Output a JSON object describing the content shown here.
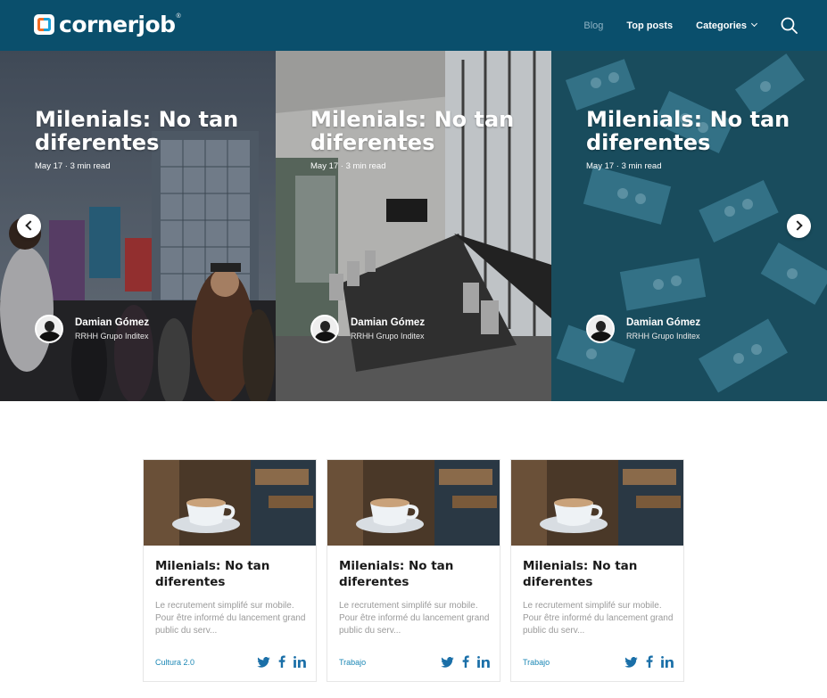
{
  "header": {
    "logo_text": "cornerjob",
    "logo_tm": "®",
    "nav": {
      "blog": "Blog",
      "top_posts": "Top posts",
      "categories": "Categories"
    }
  },
  "hero": {
    "slides": [
      {
        "title": "Milenials: No tan diferentes",
        "meta": "May 17 · 3 min read",
        "author_name": "Damian Gómez",
        "author_role": "RRHH Grupo Inditex"
      },
      {
        "title": "Milenials: No tan diferentes",
        "meta": "May 17 · 3 min read",
        "author_name": "Damian Gómez",
        "author_role": "RRHH Grupo Inditex"
      },
      {
        "title": "Milenials: No tan diferentes",
        "meta": "May 17 · 3 min read",
        "author_name": "Damian Gómez",
        "author_role": "RRHH Grupo Inditex"
      }
    ]
  },
  "cards": [
    {
      "title": "Milenials: No tan diferentes",
      "excerpt": "Le recrutement simplifé sur mobile. Pour être informé du lancement grand public du serv...",
      "category": "Cultura 2.0"
    },
    {
      "title": "Milenials: No tan diferentes",
      "excerpt": "Le recrutement simplifé sur mobile. Pour être informé du lancement grand public du serv...",
      "category": "Trabajo"
    },
    {
      "title": "Milenials: No tan diferentes",
      "excerpt": "Le recrutement simplifé sur mobile. Pour être informé du lancement grand public du serv...",
      "category": "Trabajo"
    }
  ],
  "icons": {
    "search": "search-icon",
    "prev": "chevron-left-icon",
    "next": "chevron-right-icon",
    "twitter": "twitter-icon",
    "facebook": "facebook-icon",
    "linkedin": "linkedin-icon"
  },
  "colors": {
    "header_bg": "#0a4f6c",
    "accent": "#1b87b5",
    "social": "#1a6fa8"
  }
}
